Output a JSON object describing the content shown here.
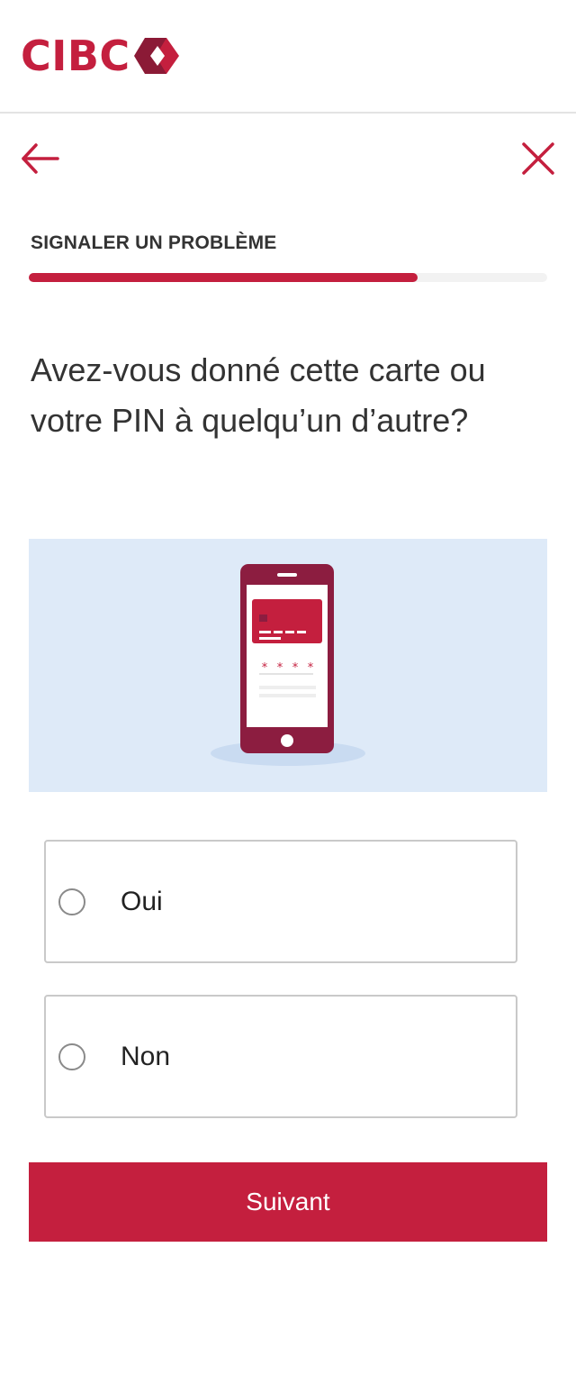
{
  "header": {
    "logo_text": "CIBC"
  },
  "nav": {
    "back_icon": "arrow-left-icon",
    "close_icon": "close-icon"
  },
  "step": {
    "label": "SIGNALER UN PROBLÈME",
    "progress_fraction": 0.75
  },
  "question": {
    "text": "Avez-vous donné cette carte ou votre PIN à quelqu’un d’autre?"
  },
  "illustration": {
    "icon": "phone-card-pin-icon"
  },
  "options": [
    {
      "label": "Oui",
      "selected": false
    },
    {
      "label": "Non",
      "selected": false
    }
  ],
  "actions": {
    "next_label": "Suivant"
  },
  "colors": {
    "brand": "#c41f3e",
    "phone": "#8c1d40",
    "illustration_bg": "#deeaf8"
  }
}
